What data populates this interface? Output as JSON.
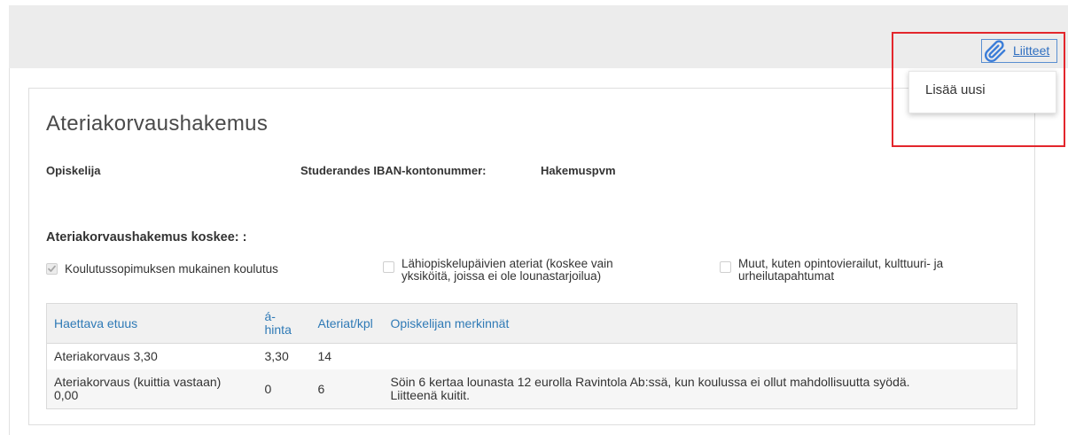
{
  "attachments": {
    "icon": "paperclip-icon",
    "link_label": "Liitteet",
    "menu": {
      "items": [
        {
          "label": "Lisää uusi"
        }
      ]
    }
  },
  "form": {
    "title": "Ateriakorvaushakemus",
    "fields": [
      {
        "label": "Opiskelija"
      },
      {
        "label": "Studerandes IBAN-kontonummer:"
      },
      {
        "label": "Hakemuspvm"
      }
    ],
    "scope": {
      "heading": "Ateriakorvaushakemus koskee: :",
      "options": [
        {
          "label": "Koulutussopimuksen mukainen koulutus",
          "checked": true,
          "disabled": true
        },
        {
          "label": "Lähiopiskelupäivien ateriat (koskee vain yksiköitä, joissa ei ole lounastarjoilua)",
          "checked": false,
          "disabled": false
        },
        {
          "label": "Muut, kuten opintovierailut, kulttuuri- ja urheilutapahtumat",
          "checked": false,
          "disabled": false
        }
      ]
    },
    "table": {
      "columns": [
        "Haettava etuus",
        "á-hinta",
        "Ateriat/kpl",
        "Opiskelijan merkinnät"
      ],
      "rows": [
        [
          "Ateriakorvaus 3,30",
          "3,30",
          "14",
          ""
        ],
        [
          "Ateriakorvaus (kuittia vastaan) 0,00",
          "0",
          "6",
          "Söin 6 kertaa lounasta 12 eurolla Ravintola Ab:ssä, kun koulussa ei ollut mahdollisuutta syödä. Liitteenä kuitit."
        ]
      ]
    }
  },
  "colors": {
    "accent": "#2f7ab6",
    "link": "#2f6fc0",
    "header_band": "#ececec",
    "table_header_bg": "#f1f1f1",
    "row_stripe": "#f6f6f6",
    "annotation": "#e3262c",
    "focus_outline": "#5a8fd1"
  }
}
